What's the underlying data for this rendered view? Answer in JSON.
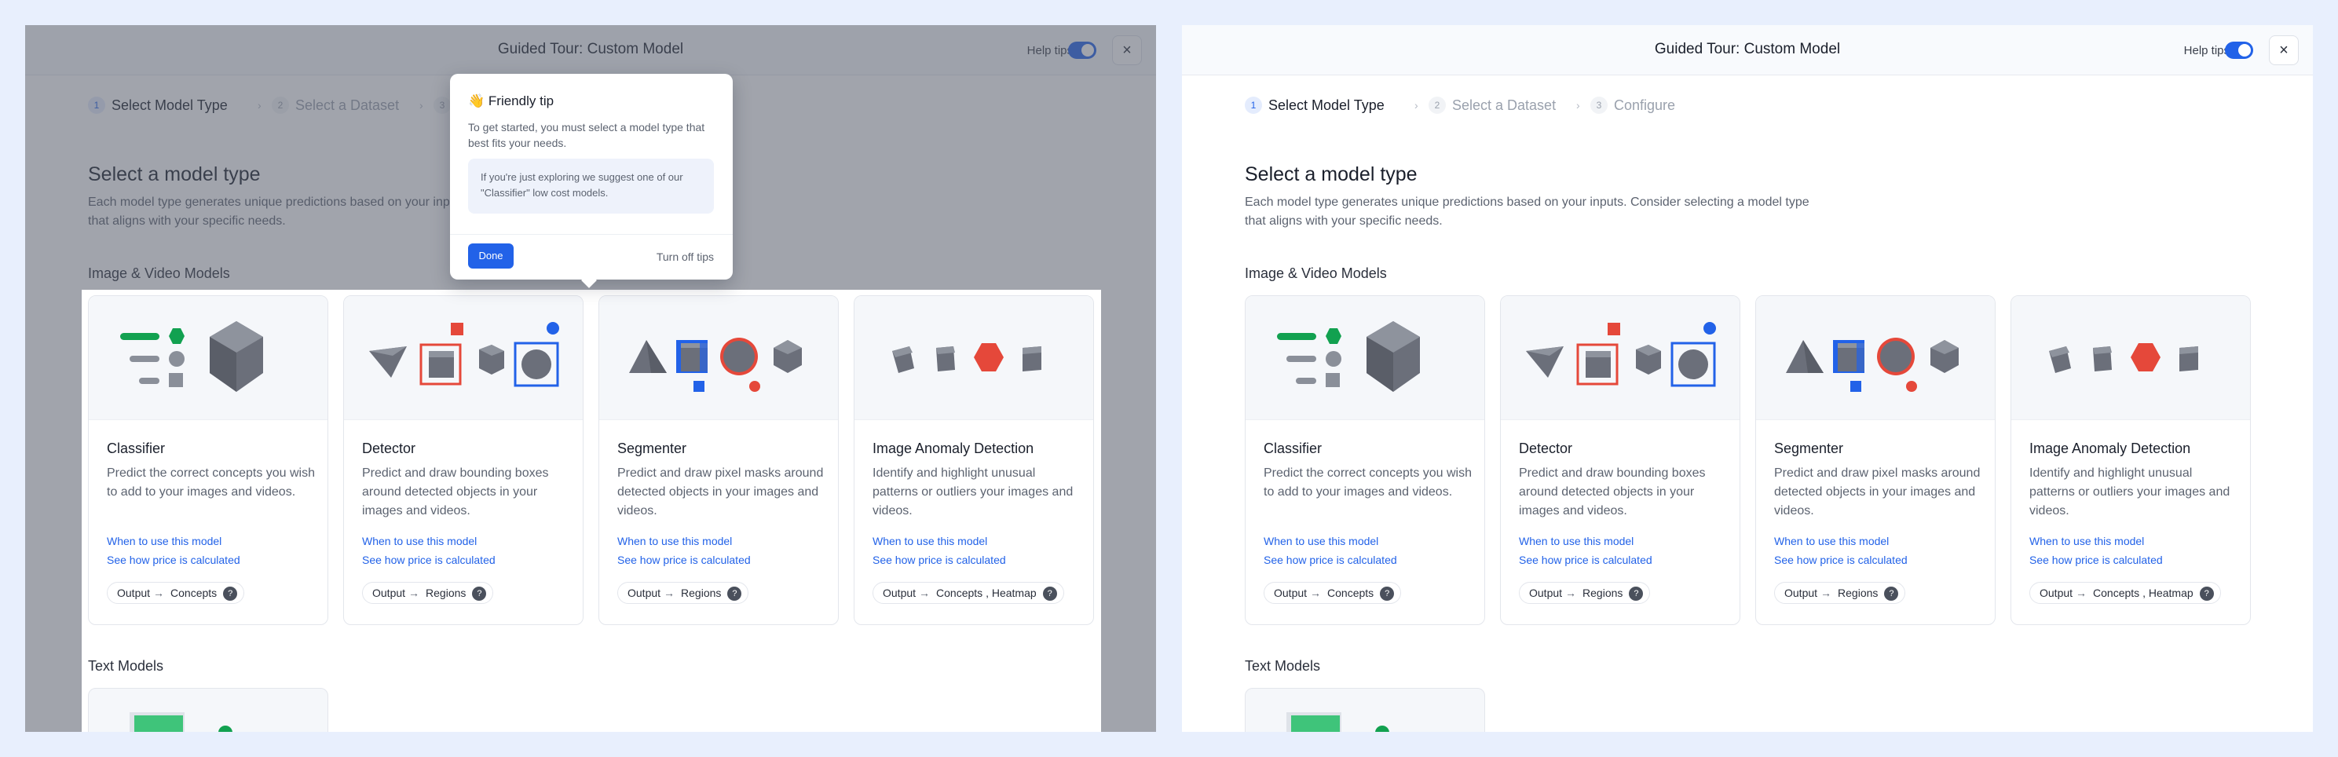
{
  "header": {
    "title": "Guided Tour: Custom Model",
    "help_tips_label": "Help tips",
    "close_icon": "×"
  },
  "steps": [
    {
      "number": "1",
      "label": "Select Model Type"
    },
    {
      "number": "2",
      "label": "Select a Dataset"
    },
    {
      "number": "3",
      "label": "Configure"
    }
  ],
  "page": {
    "title": "Select a model type",
    "description": "Each model type generates unique predictions based on your inputs. Consider selecting a model type that aligns with your specific needs.",
    "section_image_video": "Image & Video Models",
    "section_text": "Text Models"
  },
  "cards": [
    {
      "title": "Classifier",
      "description": "Predict the correct concepts you wish to add to your images and videos.",
      "link_when": "When to use this model",
      "link_price": "See how price is calculated",
      "output_label": "Output",
      "output_arrow": "→",
      "output_value": "Concepts",
      "help_icon": "?"
    },
    {
      "title": "Detector",
      "description": "Predict and draw bounding boxes around detected objects in your images and videos.",
      "link_when": "When to use this model",
      "link_price": "See how price is calculated",
      "output_label": "Output",
      "output_arrow": "→",
      "output_value": "Regions",
      "help_icon": "?"
    },
    {
      "title": "Segmenter",
      "description": "Predict and draw pixel masks around detected objects in your images and videos.",
      "link_when": "When to use this model",
      "link_price": "See how price is calculated",
      "output_label": "Output",
      "output_arrow": "→",
      "output_value": "Regions",
      "help_icon": "?"
    },
    {
      "title": "Image Anomaly Detection",
      "description": "Identify and highlight unusual patterns or outliers your images and videos.",
      "link_when": "When to use this model",
      "link_price": "See how price is calculated",
      "output_label": "Output",
      "output_arrow": "→",
      "output_value": "Concepts , Heatmap",
      "help_icon": "?"
    }
  ],
  "tip": {
    "emoji": "👋",
    "title": "Friendly tip",
    "body": "To get started, you must select a model type that best fits your needs.",
    "note": "If you're just exploring we suggest one of our \"Classifier\" low cost models.",
    "done_label": "Done",
    "turn_off_label": "Turn off tips"
  },
  "colors": {
    "accent": "#2262e8",
    "green": "#12a150",
    "red": "#e5483a",
    "shape_gray": "#6b6f7a"
  },
  "icons": {
    "close": "close-icon",
    "chevron": "chevron-right-icon",
    "arrow": "arrow-right-icon",
    "help": "question-icon",
    "wave": "wave-hand-icon"
  }
}
